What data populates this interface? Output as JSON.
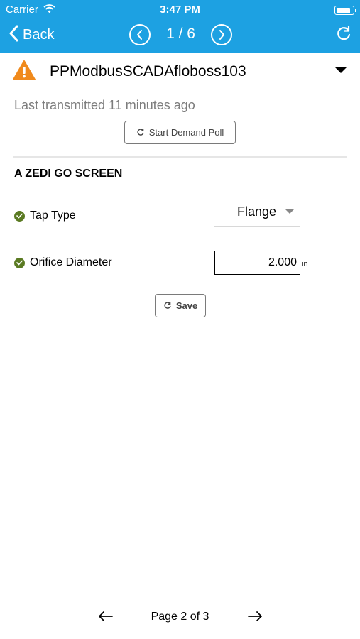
{
  "status_bar": {
    "carrier": "Carrier",
    "time": "3:47 PM",
    "battery_level": 0.9
  },
  "nav": {
    "back_label": "Back",
    "counter": "1 / 6"
  },
  "device": {
    "name": "PPModbusSCADAfloboss103",
    "alert_color": "#f08a1c"
  },
  "last_transmitted": "Last transmitted 11 minutes ago",
  "demand_poll_label": "Start Demand Poll",
  "section": {
    "title": "A ZEDI GO SCREEN",
    "fields": [
      {
        "label": "Tap Type",
        "value": "Flange"
      },
      {
        "label": "Orifice Diameter",
        "value": "2.000",
        "unit": "in"
      }
    ]
  },
  "save_label": "Save",
  "pagination": {
    "text": "Page 2 of 3"
  },
  "colors": {
    "brand": "#1da1e2",
    "ok": "#5a7a22"
  }
}
